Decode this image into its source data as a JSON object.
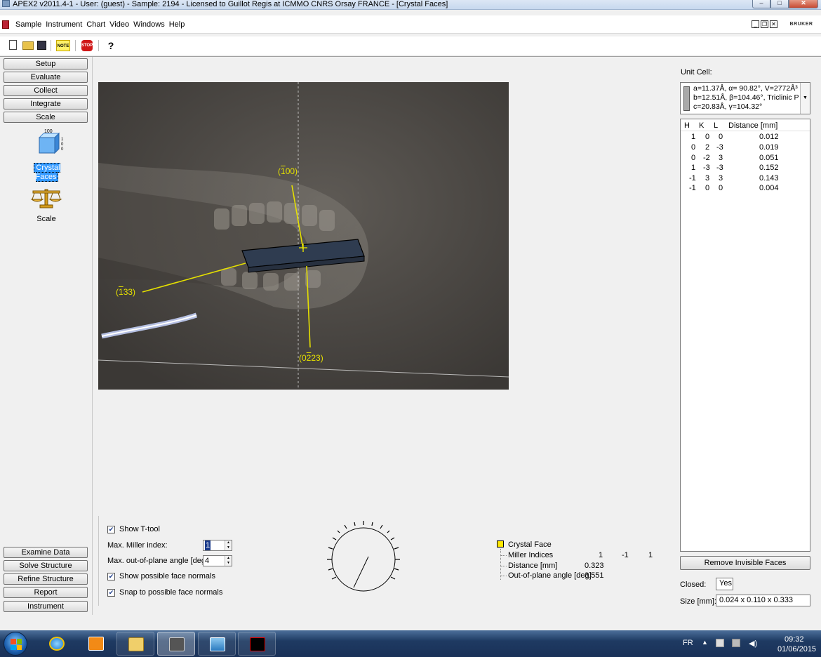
{
  "window": {
    "title": "APEX2 v2011.4-1 - User: (guest) - Sample: 2194 - Licensed to Guillot Regis at ICMMO CNRS Orsay FRANCE - [Crystal Faces]"
  },
  "menu": {
    "items": [
      "Sample",
      "Instrument",
      "Chart",
      "Video",
      "Windows",
      "Help"
    ],
    "brand": "BRUKER"
  },
  "toolbar": {
    "note_label": "NOTE",
    "stop_label": "STOP",
    "help_label": "?"
  },
  "nav": {
    "top": [
      "Setup",
      "Evaluate",
      "Collect",
      "Integrate",
      "Scale"
    ],
    "bottom": [
      "Examine Data",
      "Solve Structure",
      "Refine Structure",
      "Report",
      "Instrument"
    ],
    "plugins": [
      {
        "label": "Crystal Faces",
        "icon_text": [
          "100",
          "1",
          "0",
          "0"
        ],
        "selected": true
      },
      {
        "label": "Scale",
        "selected": false
      }
    ]
  },
  "viewer": {
    "faces": [
      {
        "label_bar": "1",
        "label_rest": "00",
        "pre": "("
      },
      {
        "label_bar": "1",
        "label_rest": "33",
        "pre": "("
      },
      {
        "label_bar": "",
        "label_rest": "23",
        "pre": "(0",
        "bar_after": "2"
      }
    ],
    "label_100": "(100)",
    "label_133": "(133)",
    "label_023": "(023)"
  },
  "unit_cell": {
    "label": "Unit Cell:",
    "lines": [
      "a=11.37Å,  α=  90.82°,  V=2772Å³",
      "b=12.51Å,  β=104.46°,  Triclinic P",
      "c=20.83Å,  γ=104.32°"
    ]
  },
  "faces_table": {
    "headers": [
      "H",
      "K",
      "L",
      "Distance [mm]"
    ],
    "rows": [
      [
        "1",
        "0",
        "0",
        "0.012"
      ],
      [
        "0",
        "2",
        "-3",
        "0.019"
      ],
      [
        "0",
        "-2",
        "3",
        "0.051"
      ],
      [
        "1",
        "-3",
        "-3",
        "0.152"
      ],
      [
        "-1",
        "3",
        "3",
        "0.143"
      ],
      [
        "-1",
        "0",
        "0",
        "0.004"
      ]
    ]
  },
  "right_panel": {
    "remove_button": "Remove Invisible Faces",
    "closed_label": "Closed:",
    "closed_value": "Yes",
    "size_label": "Size [mm]:",
    "size_value": "0.024 x 0.110 x 0.333"
  },
  "controls": {
    "show_ttool": "Show T-tool",
    "max_miller_label": "Max. Miller index:",
    "max_miller_value": "1",
    "max_angle_label": "Max. out-of-plane angle [deg]:",
    "max_angle_value": "4",
    "show_normals": "Show possible face normals",
    "snap_normals": "Snap to possible face normals"
  },
  "crystal_face": {
    "title": "Crystal Face",
    "miller_label": "Miller Indices",
    "miller_values": [
      "1",
      "-1",
      "1"
    ],
    "distance_label": "Distance [mm]",
    "distance_value": "0.323",
    "angle_label": "Out-of-plane angle [deg]",
    "angle_value": "3.551",
    "swatch_color": "#ffe800"
  },
  "taskbar": {
    "lang": "FR",
    "time": "09:32",
    "date": "01/06/2015"
  }
}
